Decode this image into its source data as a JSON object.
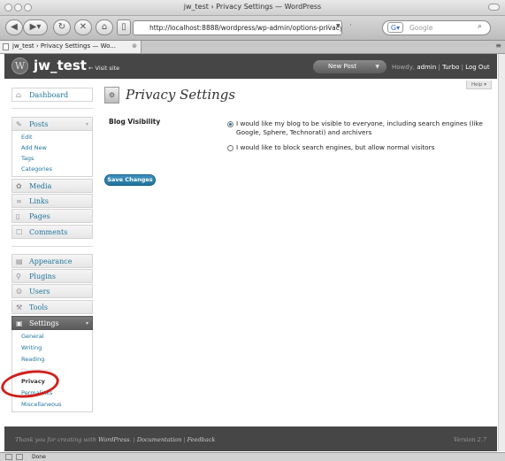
{
  "window": {
    "title": "jw_test › Privacy Settings — WordPress"
  },
  "browser": {
    "url": "http://localhost:8888/wordpress/wp-admin/options-privacy",
    "search_placeholder": "Google",
    "tab_label": "jw_test › Privacy Settings — Wo...",
    "status": "Done"
  },
  "header": {
    "blog_name": "jw_test",
    "visit_site": "← Visit site",
    "new_post": "New Post",
    "howdy": "Howdy,",
    "user": "admin",
    "sep1": "|",
    "turbo": "Turbo",
    "sep2": "|",
    "logout": "Log Out"
  },
  "help_label": "Help ▾",
  "sidebar": {
    "dashboard": "Dashboard",
    "posts": "Posts",
    "posts_sub": [
      "Edit",
      "Add New",
      "Tags",
      "Categories"
    ],
    "media": "Media",
    "links": "Links",
    "pages": "Pages",
    "comments": "Comments",
    "appearance": "Appearance",
    "plugins": "Plugins",
    "users": "Users",
    "tools": "Tools",
    "settings": "Settings",
    "settings_sub": [
      "General",
      "Writing",
      "Reading",
      "Discussion",
      "Privacy",
      "Permalinks",
      "Miscellaneous"
    ]
  },
  "main": {
    "title": "Privacy Settings",
    "field_label": "Blog Visibility",
    "option1": "I would like my blog to be visible to everyone, including search engines (like Google, Sphere, Technorati) and archivers",
    "option2": "I would like to block search engines, but allow normal visitors",
    "selected_option": 1,
    "save_button": "Save Changes"
  },
  "footer": {
    "thanks": "Thank you for creating with",
    "wordpress": "WordPress",
    "sep1": "|",
    "documentation": "Documentation",
    "sep2": "|",
    "feedback": "Feedback",
    "version": "Version 2.7"
  },
  "colors": {
    "accent": "#21759b",
    "header_bg": "#464646",
    "highlight_circle": "#d0201d"
  }
}
